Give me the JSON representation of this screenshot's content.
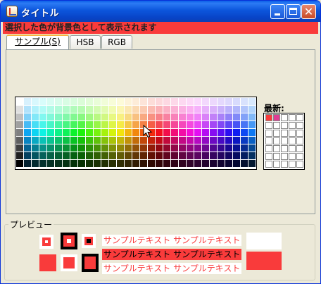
{
  "window": {
    "title": "タイトル",
    "title_color": "#0C56DC",
    "close_glyph": "✕"
  },
  "banner": {
    "text": "選択した色が背景色として表示されます",
    "background": "#F93B3B"
  },
  "tabs": [
    {
      "label": "サンプル(S)",
      "active": true
    },
    {
      "label": "HSB",
      "active": false
    },
    {
      "label": "RGB",
      "active": false
    }
  ],
  "swatches": {
    "recent_label": "最新:",
    "recent_colors": [
      "#F93B3B",
      "#E03C94"
    ],
    "recent_columns": 5,
    "recent_rows": 7,
    "main_columns": 31,
    "main_rows": 9
  },
  "preview": {
    "label": "プレビュー",
    "sample_text": "サンプルテキスト サンプルテキスト",
    "accent_color": "#F93B3B",
    "icons": [
      "small-square-icon",
      "bordered-square-icon",
      "dark-inner-square-icon",
      "solid-square-icon",
      "small-solid-square-icon",
      "framed-square-icon"
    ]
  }
}
